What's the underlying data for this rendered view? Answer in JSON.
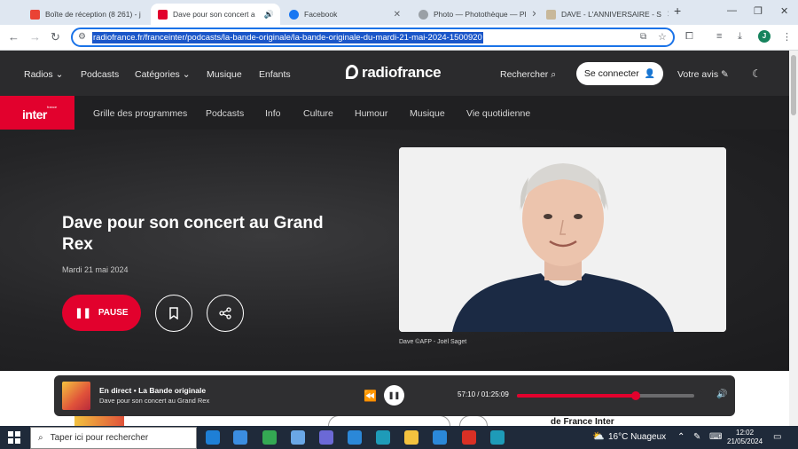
{
  "browser": {
    "tabs": [
      {
        "label": "Boîte de réception (8 261) - j",
        "icon_color": "#ea4335"
      },
      {
        "label": "Dave pour son concert a",
        "icon_color": "#e2012d",
        "active": true
      },
      {
        "label": "Facebook",
        "icon_color": "#1877f2"
      },
      {
        "label": "Photo — Photothèque — Pl",
        "icon_color": "#9aa0a6"
      },
      {
        "label": "DAVE - L'ANNIVERSAIRE - S",
        "icon_color": "#c8b89a"
      }
    ],
    "new_tab": "+",
    "url": "radiofrance.fr/franceinter/podcasts/la-bande-originale/la-bande-originale-du-mardi-21-mai-2024-1500920",
    "profile_initial": "J"
  },
  "site": {
    "nav": {
      "radios": "Radios",
      "podcasts": "Podcasts",
      "categories": "Catégories",
      "musique": "Musique",
      "enfants": "Enfants",
      "logo": "radiofrance",
      "search": "Rechercher",
      "connect": "Se connecter",
      "feedback": "Votre avis"
    },
    "brand": {
      "small": "france",
      "name": "inter"
    },
    "subnav": [
      "Grille des programmes",
      "Podcasts",
      "Info",
      "Culture",
      "Humour",
      "Musique",
      "Vie quotidienne"
    ]
  },
  "episode": {
    "title": "Dave pour son concert au Grand Rex",
    "date": "Mardi 21 mai 2024",
    "pause_label": "PAUSE",
    "photo_caption": "Dave ©AFP - Joël Saget"
  },
  "below": {
    "france_inter_text": "de France Inter"
  },
  "player": {
    "live_label": "En direct",
    "show": "La Bande originale",
    "episode": "Dave pour son concert au Grand Rex",
    "time": "57:10 / 01:25:09",
    "progress": 0.67
  },
  "taskbar": {
    "search_placeholder": "Taper ici pour rechercher",
    "weather": "16°C  Nuageux",
    "time": "12:02",
    "date": "21/05/2024",
    "apps": [
      "#1e7fd6",
      "#3b8de0",
      "#34a853",
      "#6aa7e6",
      "#6b69d6",
      "#2b88d8",
      "#1e9bb8",
      "#f3c23f",
      "#2b88d8",
      "#d93025",
      "#1e9bb8"
    ]
  }
}
